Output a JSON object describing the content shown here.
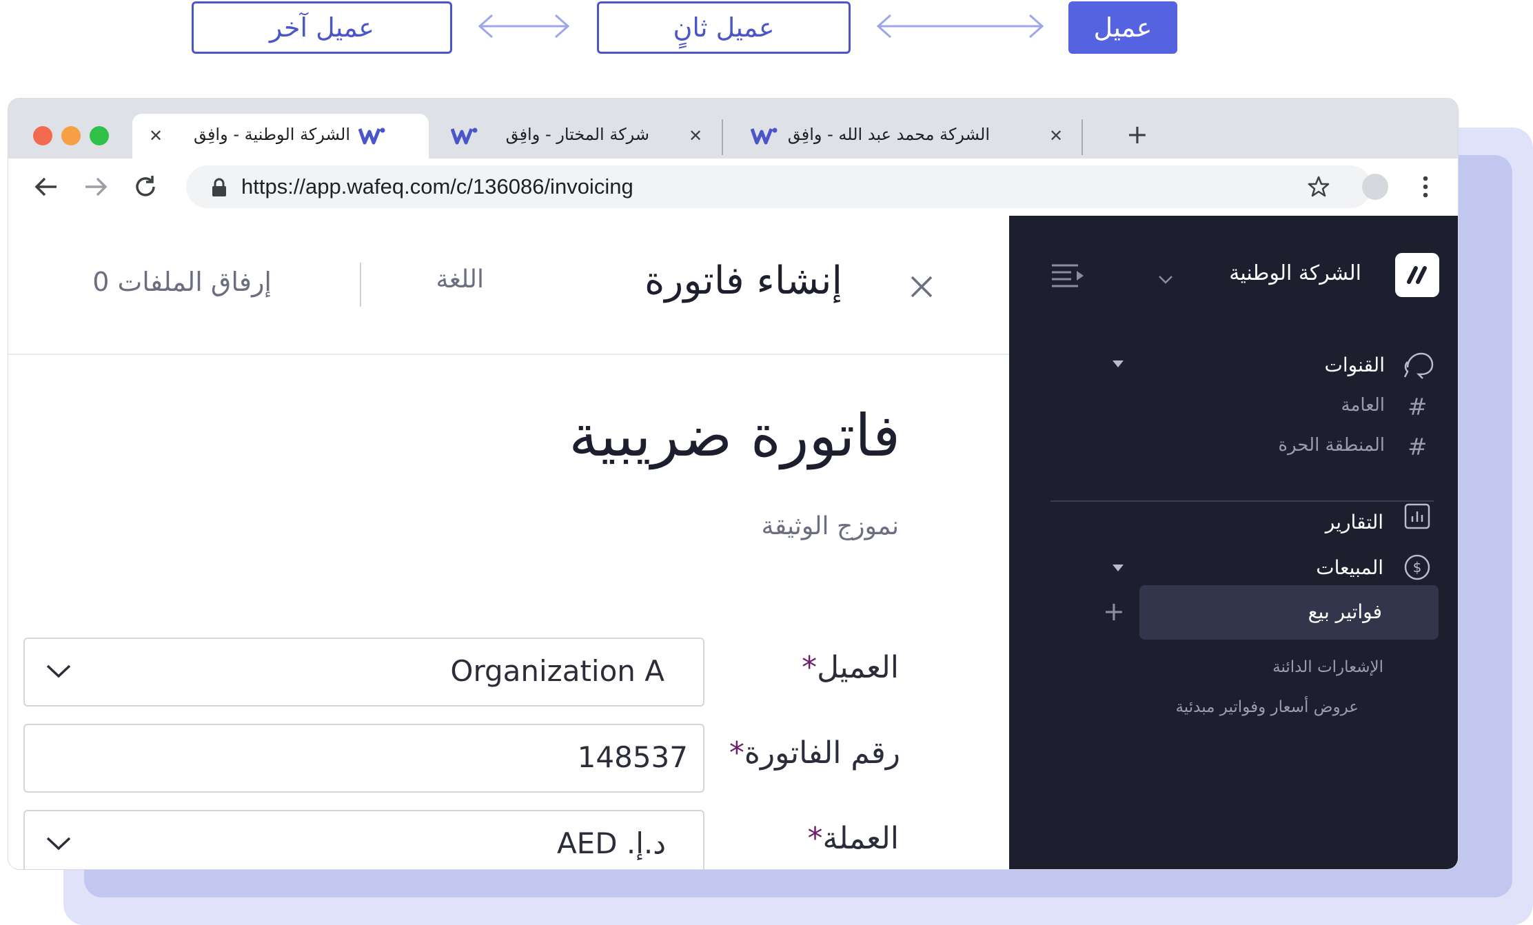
{
  "top_buttons": {
    "client_label": "عميل",
    "second_client_label": "عميل ثانٍ",
    "another_client_label": "عميل آخر"
  },
  "browser": {
    "tabs": [
      {
        "title": "الشركة الوطنية - وافِق",
        "active": true
      },
      {
        "title": "شركة المختار - وافِق",
        "active": false
      },
      {
        "title": "الشركة محمد عبد الله - وافِق",
        "active": false
      }
    ],
    "new_tab_label": "+",
    "url": "https://app.wafeq.com/c/136086/invoicing"
  },
  "header": {
    "close_label": "✕",
    "title": "إنشاء فاتورة",
    "language_label": "اللغة",
    "attach_label": "إرفاق الملفات 0"
  },
  "document": {
    "title": "فاتورة ضريبية",
    "template_label": "نموزج الوثيقة"
  },
  "form": {
    "customer_label": "العميل",
    "customer_value": "Organization A",
    "invoice_number_label": "رقم الفاتورة",
    "invoice_number_value": "148537",
    "currency_label": "العملة",
    "currency_value": "AED .د.إ",
    "required_mark": "*"
  },
  "sidebar": {
    "company_name": "الشركة الوطنية",
    "channels_label": "القنوات",
    "channel_items": [
      "العامة",
      "المنطقة الحرة"
    ],
    "reports_label": "التقارير",
    "sales_label": "المبيعات",
    "sales_items": {
      "active": "فواتير بيع",
      "credit_notes": "الإشعارات الدائنة",
      "quotes": "عروض أسعار وفواتير مبدئية"
    }
  },
  "colors": {
    "accent": "#5563e0",
    "sidebar_bg": "#1d1f2e",
    "required_mark": "#6b1f6b"
  }
}
